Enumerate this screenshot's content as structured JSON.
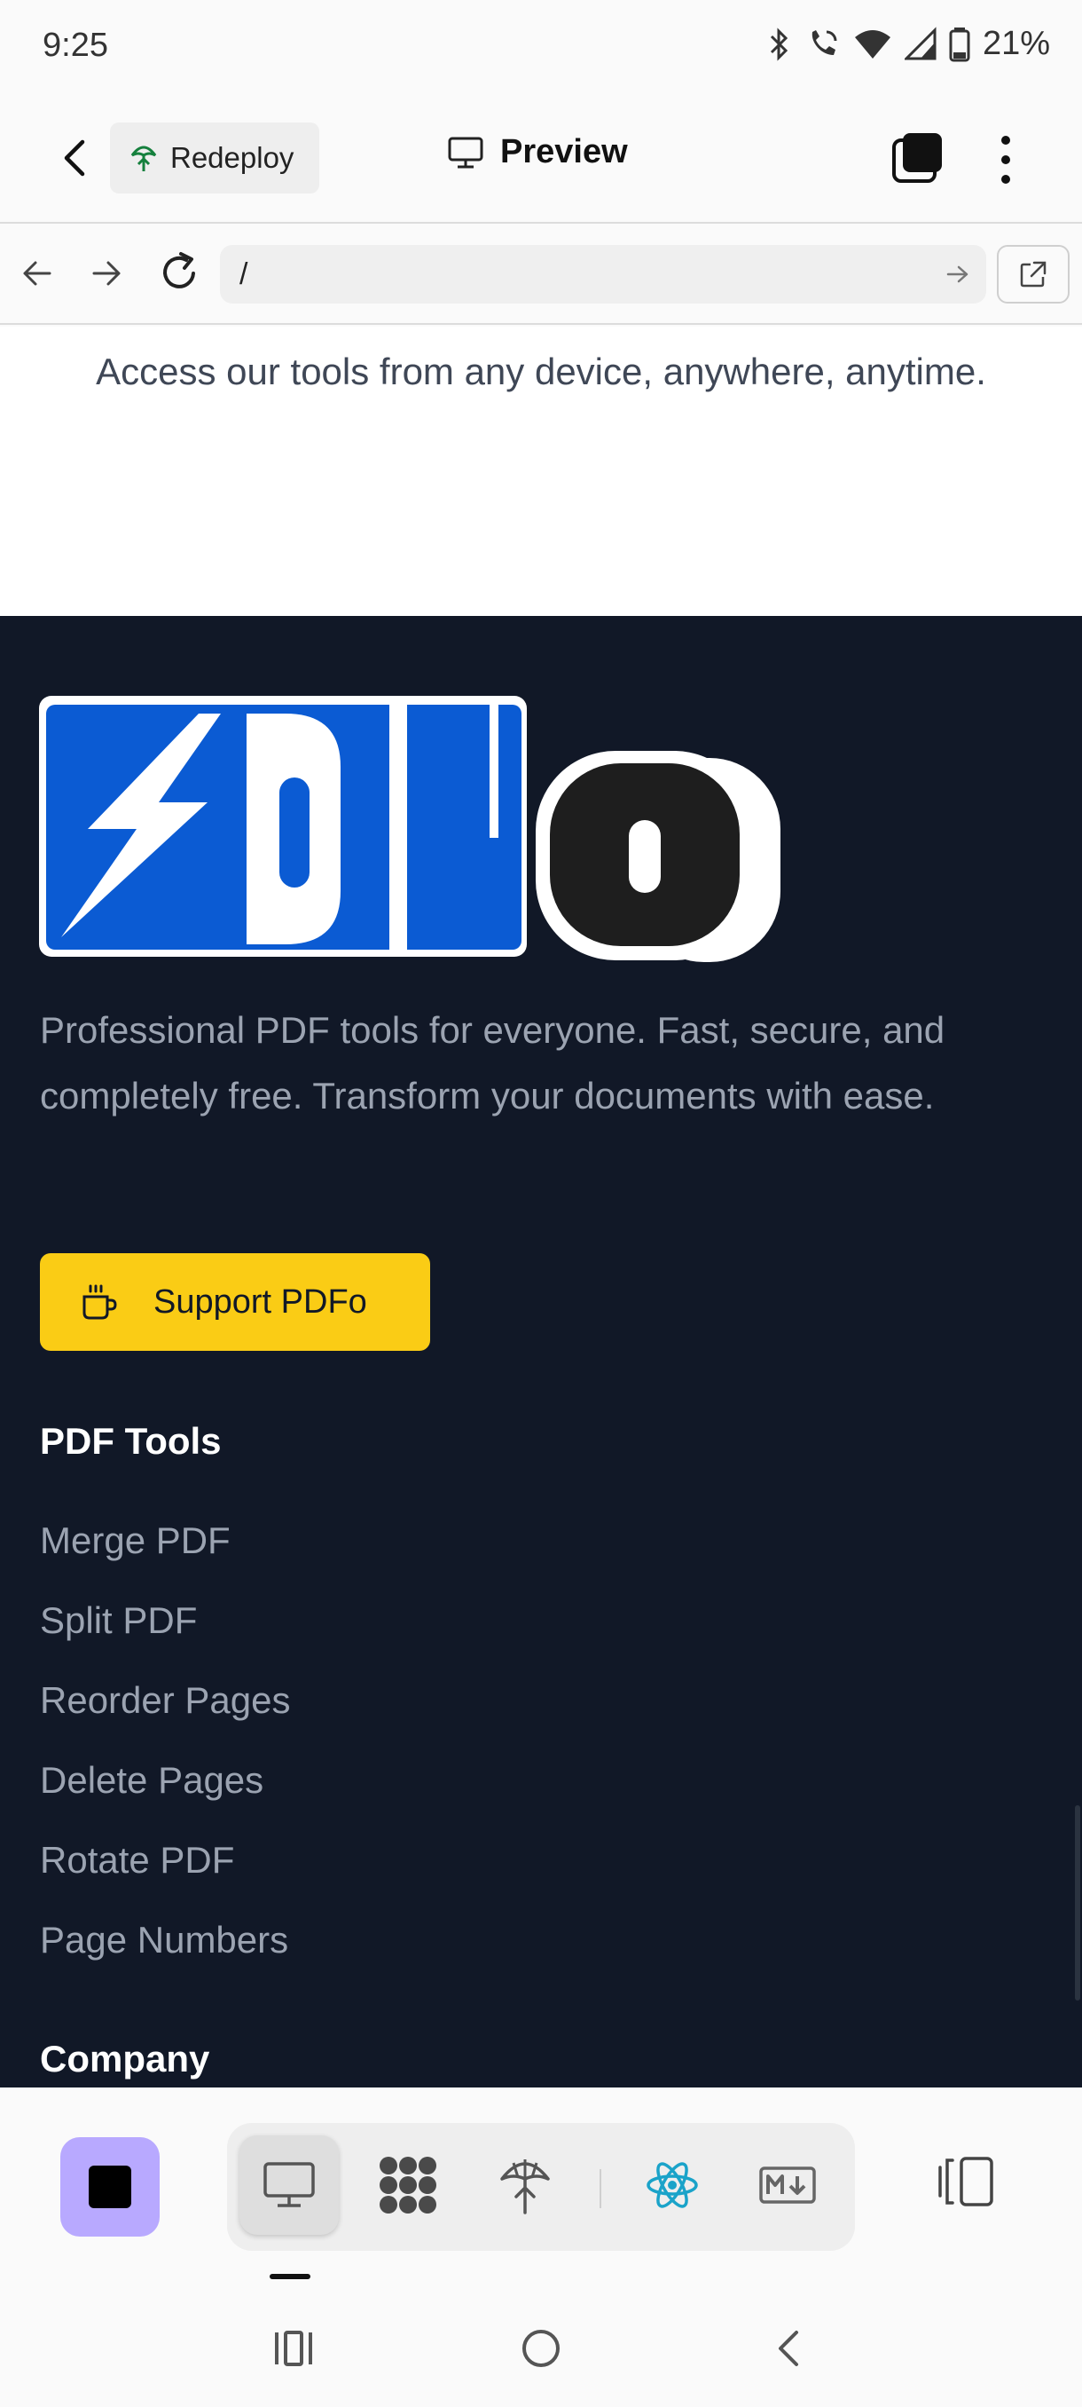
{
  "status_bar": {
    "time": "9:25",
    "battery": "21%",
    "icons": [
      "bluetooth-icon",
      "wifi-calling-icon",
      "wifi-icon",
      "signal-icon",
      "battery-icon"
    ]
  },
  "header": {
    "redeploy_label": "Redeploy",
    "title": "Preview"
  },
  "url_bar": {
    "url": "/"
  },
  "page": {
    "access_text": "Access our tools from any device, anywhere, anytime.",
    "footer": {
      "description": "Professional PDF tools for everyone. Fast, secure, and completely free. Transform your documents with ease.",
      "support_label": "Support PDFo",
      "tools_title": "PDF Tools",
      "tools": [
        "Merge PDF",
        "Split PDF",
        "Reorder Pages",
        "Delete Pages",
        "Rotate PDF",
        "Page Numbers"
      ],
      "company_title": "Company"
    }
  },
  "colors": {
    "footer_bg": "#111827",
    "support_button": "#facc15",
    "stop_button": "#b8a9ff",
    "logo_blue": "#0b5bd3",
    "react_accent": "#1aa3c9"
  },
  "bottom_toolbar": {
    "items": [
      "stop-icon",
      "preview-monitor-icon",
      "integrations-icon",
      "deploy-icon",
      "react-icon",
      "markdown-icon",
      "layout-toggle-icon"
    ]
  }
}
